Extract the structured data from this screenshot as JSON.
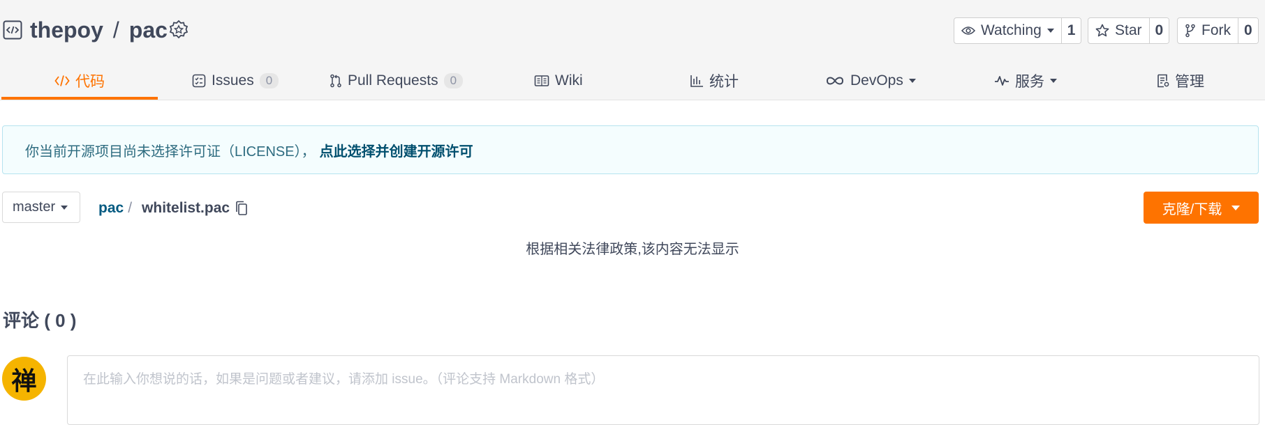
{
  "repo": {
    "owner": "thepoy",
    "separator": "/",
    "name": "pac"
  },
  "actions": {
    "watching": {
      "label": "Watching",
      "count": "1"
    },
    "star": {
      "label": "Star",
      "count": "0"
    },
    "fork": {
      "label": "Fork",
      "count": "0"
    }
  },
  "tabs": [
    {
      "label": "代码",
      "icon": "code-icon"
    },
    {
      "label": "Issues",
      "count": "0",
      "icon": "issues-icon"
    },
    {
      "label": "Pull Requests",
      "count": "0",
      "icon": "pull-request-icon"
    },
    {
      "label": "Wiki",
      "icon": "wiki-icon"
    },
    {
      "label": "统计",
      "icon": "stats-icon"
    },
    {
      "label": "DevOps",
      "icon": "devops-icon"
    },
    {
      "label": "服务",
      "icon": "service-icon"
    },
    {
      "label": "管理",
      "icon": "manage-icon"
    }
  ],
  "notice": {
    "text": "你当前开源项目尚未选择许可证（LICENSE），",
    "link": "点此选择并创建开源许可"
  },
  "path": {
    "branch": "master",
    "repo": "pac",
    "separator": "/",
    "file": "whitelist.pac"
  },
  "clone_label": "克隆/下载",
  "blocked_message": "根据相关法律政策,该内容无法显示",
  "comments": {
    "title": "评论 ( 0 )",
    "avatar_char": "禅",
    "placeholder": "在此输入你想说的话，如果是问题或者建议，请添加 issue。（评论支持 Markdown 格式）"
  },
  "colors": {
    "accent": "#fe7300",
    "link": "#005980",
    "notice_bg": "#f4fdfe",
    "avatar_bg": "#f5b400"
  }
}
